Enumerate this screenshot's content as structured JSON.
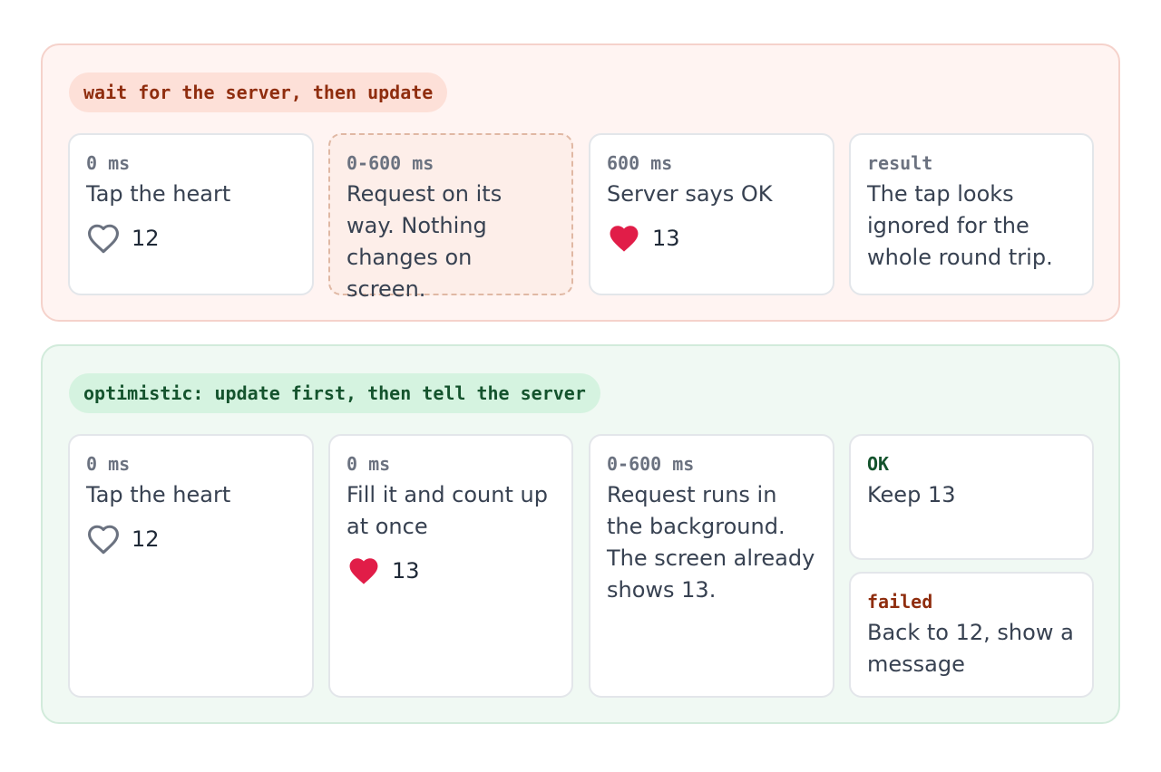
{
  "wait_panel": {
    "label": "wait for the server, then update",
    "steps": [
      {
        "time": "0 ms",
        "text": "Tap the heart",
        "heart": "outline",
        "count": "12"
      },
      {
        "time": "0-600 ms",
        "text": "Request on its way. Nothing changes on screen."
      },
      {
        "time": "600 ms",
        "text": "Server says OK",
        "heart": "filled",
        "count": "13"
      },
      {
        "time": "result",
        "text": "The tap looks ignored for the whole round trip."
      }
    ]
  },
  "optimistic_panel": {
    "label": "optimistic: update first, then tell the server",
    "steps": [
      {
        "time": "0 ms",
        "text": "Tap the heart",
        "heart": "outline",
        "count": "12"
      },
      {
        "time": "0 ms",
        "text": "Fill it and count up at once",
        "heart": "filled",
        "count": "13"
      },
      {
        "time": "0-600 ms",
        "text": "Request runs in the background. The screen already shows 13."
      }
    ],
    "outcomes": {
      "ok": {
        "label": "OK",
        "text": "Keep 13"
      },
      "failed": {
        "label": "failed",
        "text": "Back to 12, show a message"
      }
    }
  },
  "colors": {
    "heart_filled": "#e11d48",
    "heart_outline": "#6b7280",
    "wait_accent": "#8f2d0e",
    "optimistic_accent": "#14532d"
  }
}
